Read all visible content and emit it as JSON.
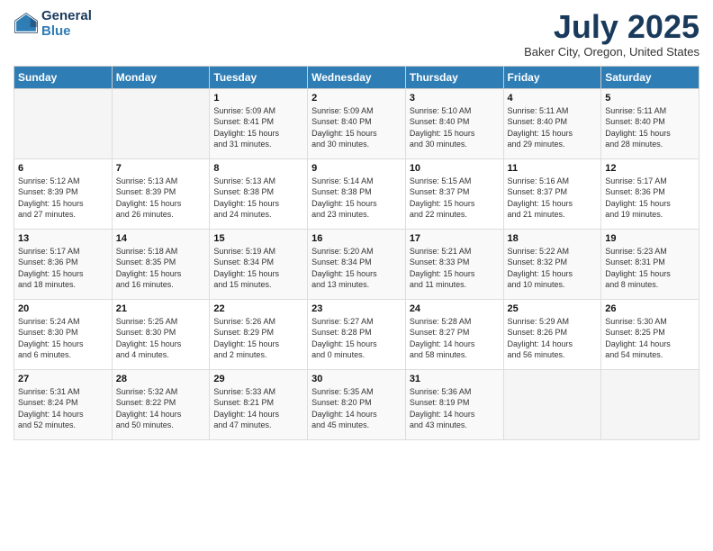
{
  "logo": {
    "general": "General",
    "blue": "Blue"
  },
  "header": {
    "month": "July 2025",
    "location": "Baker City, Oregon, United States"
  },
  "weekdays": [
    "Sunday",
    "Monday",
    "Tuesday",
    "Wednesday",
    "Thursday",
    "Friday",
    "Saturday"
  ],
  "weeks": [
    [
      {
        "day": "",
        "info": ""
      },
      {
        "day": "",
        "info": ""
      },
      {
        "day": "1",
        "info": "Sunrise: 5:09 AM\nSunset: 8:41 PM\nDaylight: 15 hours\nand 31 minutes."
      },
      {
        "day": "2",
        "info": "Sunrise: 5:09 AM\nSunset: 8:40 PM\nDaylight: 15 hours\nand 30 minutes."
      },
      {
        "day": "3",
        "info": "Sunrise: 5:10 AM\nSunset: 8:40 PM\nDaylight: 15 hours\nand 30 minutes."
      },
      {
        "day": "4",
        "info": "Sunrise: 5:11 AM\nSunset: 8:40 PM\nDaylight: 15 hours\nand 29 minutes."
      },
      {
        "day": "5",
        "info": "Sunrise: 5:11 AM\nSunset: 8:40 PM\nDaylight: 15 hours\nand 28 minutes."
      }
    ],
    [
      {
        "day": "6",
        "info": "Sunrise: 5:12 AM\nSunset: 8:39 PM\nDaylight: 15 hours\nand 27 minutes."
      },
      {
        "day": "7",
        "info": "Sunrise: 5:13 AM\nSunset: 8:39 PM\nDaylight: 15 hours\nand 26 minutes."
      },
      {
        "day": "8",
        "info": "Sunrise: 5:13 AM\nSunset: 8:38 PM\nDaylight: 15 hours\nand 24 minutes."
      },
      {
        "day": "9",
        "info": "Sunrise: 5:14 AM\nSunset: 8:38 PM\nDaylight: 15 hours\nand 23 minutes."
      },
      {
        "day": "10",
        "info": "Sunrise: 5:15 AM\nSunset: 8:37 PM\nDaylight: 15 hours\nand 22 minutes."
      },
      {
        "day": "11",
        "info": "Sunrise: 5:16 AM\nSunset: 8:37 PM\nDaylight: 15 hours\nand 21 minutes."
      },
      {
        "day": "12",
        "info": "Sunrise: 5:17 AM\nSunset: 8:36 PM\nDaylight: 15 hours\nand 19 minutes."
      }
    ],
    [
      {
        "day": "13",
        "info": "Sunrise: 5:17 AM\nSunset: 8:36 PM\nDaylight: 15 hours\nand 18 minutes."
      },
      {
        "day": "14",
        "info": "Sunrise: 5:18 AM\nSunset: 8:35 PM\nDaylight: 15 hours\nand 16 minutes."
      },
      {
        "day": "15",
        "info": "Sunrise: 5:19 AM\nSunset: 8:34 PM\nDaylight: 15 hours\nand 15 minutes."
      },
      {
        "day": "16",
        "info": "Sunrise: 5:20 AM\nSunset: 8:34 PM\nDaylight: 15 hours\nand 13 minutes."
      },
      {
        "day": "17",
        "info": "Sunrise: 5:21 AM\nSunset: 8:33 PM\nDaylight: 15 hours\nand 11 minutes."
      },
      {
        "day": "18",
        "info": "Sunrise: 5:22 AM\nSunset: 8:32 PM\nDaylight: 15 hours\nand 10 minutes."
      },
      {
        "day": "19",
        "info": "Sunrise: 5:23 AM\nSunset: 8:31 PM\nDaylight: 15 hours\nand 8 minutes."
      }
    ],
    [
      {
        "day": "20",
        "info": "Sunrise: 5:24 AM\nSunset: 8:30 PM\nDaylight: 15 hours\nand 6 minutes."
      },
      {
        "day": "21",
        "info": "Sunrise: 5:25 AM\nSunset: 8:30 PM\nDaylight: 15 hours\nand 4 minutes."
      },
      {
        "day": "22",
        "info": "Sunrise: 5:26 AM\nSunset: 8:29 PM\nDaylight: 15 hours\nand 2 minutes."
      },
      {
        "day": "23",
        "info": "Sunrise: 5:27 AM\nSunset: 8:28 PM\nDaylight: 15 hours\nand 0 minutes."
      },
      {
        "day": "24",
        "info": "Sunrise: 5:28 AM\nSunset: 8:27 PM\nDaylight: 14 hours\nand 58 minutes."
      },
      {
        "day": "25",
        "info": "Sunrise: 5:29 AM\nSunset: 8:26 PM\nDaylight: 14 hours\nand 56 minutes."
      },
      {
        "day": "26",
        "info": "Sunrise: 5:30 AM\nSunset: 8:25 PM\nDaylight: 14 hours\nand 54 minutes."
      }
    ],
    [
      {
        "day": "27",
        "info": "Sunrise: 5:31 AM\nSunset: 8:24 PM\nDaylight: 14 hours\nand 52 minutes."
      },
      {
        "day": "28",
        "info": "Sunrise: 5:32 AM\nSunset: 8:22 PM\nDaylight: 14 hours\nand 50 minutes."
      },
      {
        "day": "29",
        "info": "Sunrise: 5:33 AM\nSunset: 8:21 PM\nDaylight: 14 hours\nand 47 minutes."
      },
      {
        "day": "30",
        "info": "Sunrise: 5:35 AM\nSunset: 8:20 PM\nDaylight: 14 hours\nand 45 minutes."
      },
      {
        "day": "31",
        "info": "Sunrise: 5:36 AM\nSunset: 8:19 PM\nDaylight: 14 hours\nand 43 minutes."
      },
      {
        "day": "",
        "info": ""
      },
      {
        "day": "",
        "info": ""
      }
    ]
  ]
}
